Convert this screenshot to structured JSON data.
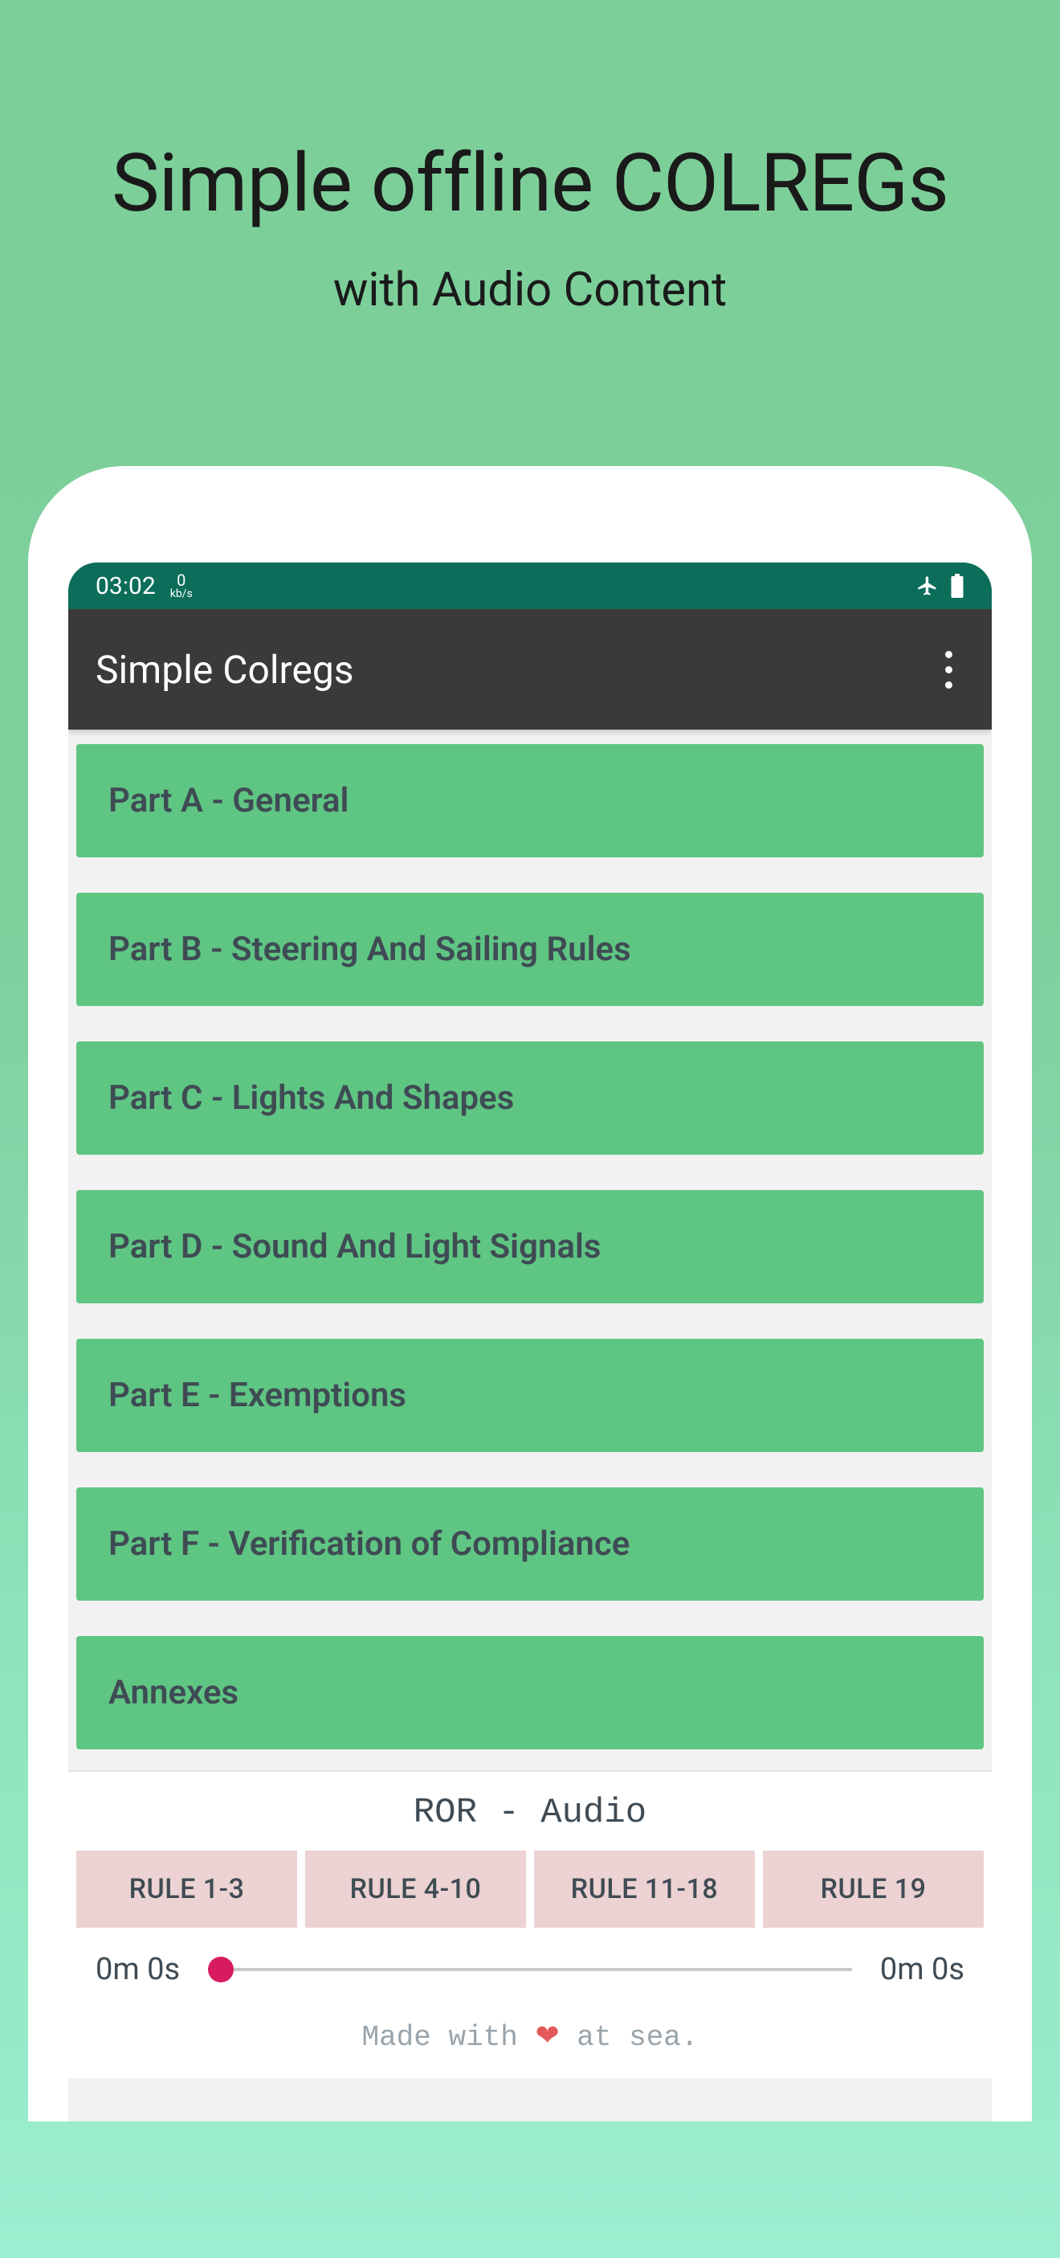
{
  "hero": {
    "title": "Simple offline COLREGs",
    "subtitle": "with Audio Content"
  },
  "status": {
    "time": "03:02",
    "kbps_value": "0",
    "kbps_unit": "kb/s"
  },
  "appbar": {
    "title": "Simple Colregs"
  },
  "parts": [
    {
      "label": "Part A - General"
    },
    {
      "label": "Part B - Steering And Sailing Rules"
    },
    {
      "label": "Part C - Lights And Shapes"
    },
    {
      "label": "Part D - Sound And Light Signals"
    },
    {
      "label": "Part E - Exemptions"
    },
    {
      "label": "Part F - Verification of Compliance"
    },
    {
      "label": "Annexes"
    }
  ],
  "audio": {
    "title": "ROR - Audio",
    "tabs": [
      {
        "label": "RULE 1-3"
      },
      {
        "label": "RULE 4-10"
      },
      {
        "label": "RULE 11-18"
      },
      {
        "label": "RULE 19"
      }
    ],
    "time_start": "0m 0s",
    "time_end": "0m 0s"
  },
  "footer": {
    "pre": "Made with ",
    "heart": "❤",
    "post": " at sea."
  }
}
